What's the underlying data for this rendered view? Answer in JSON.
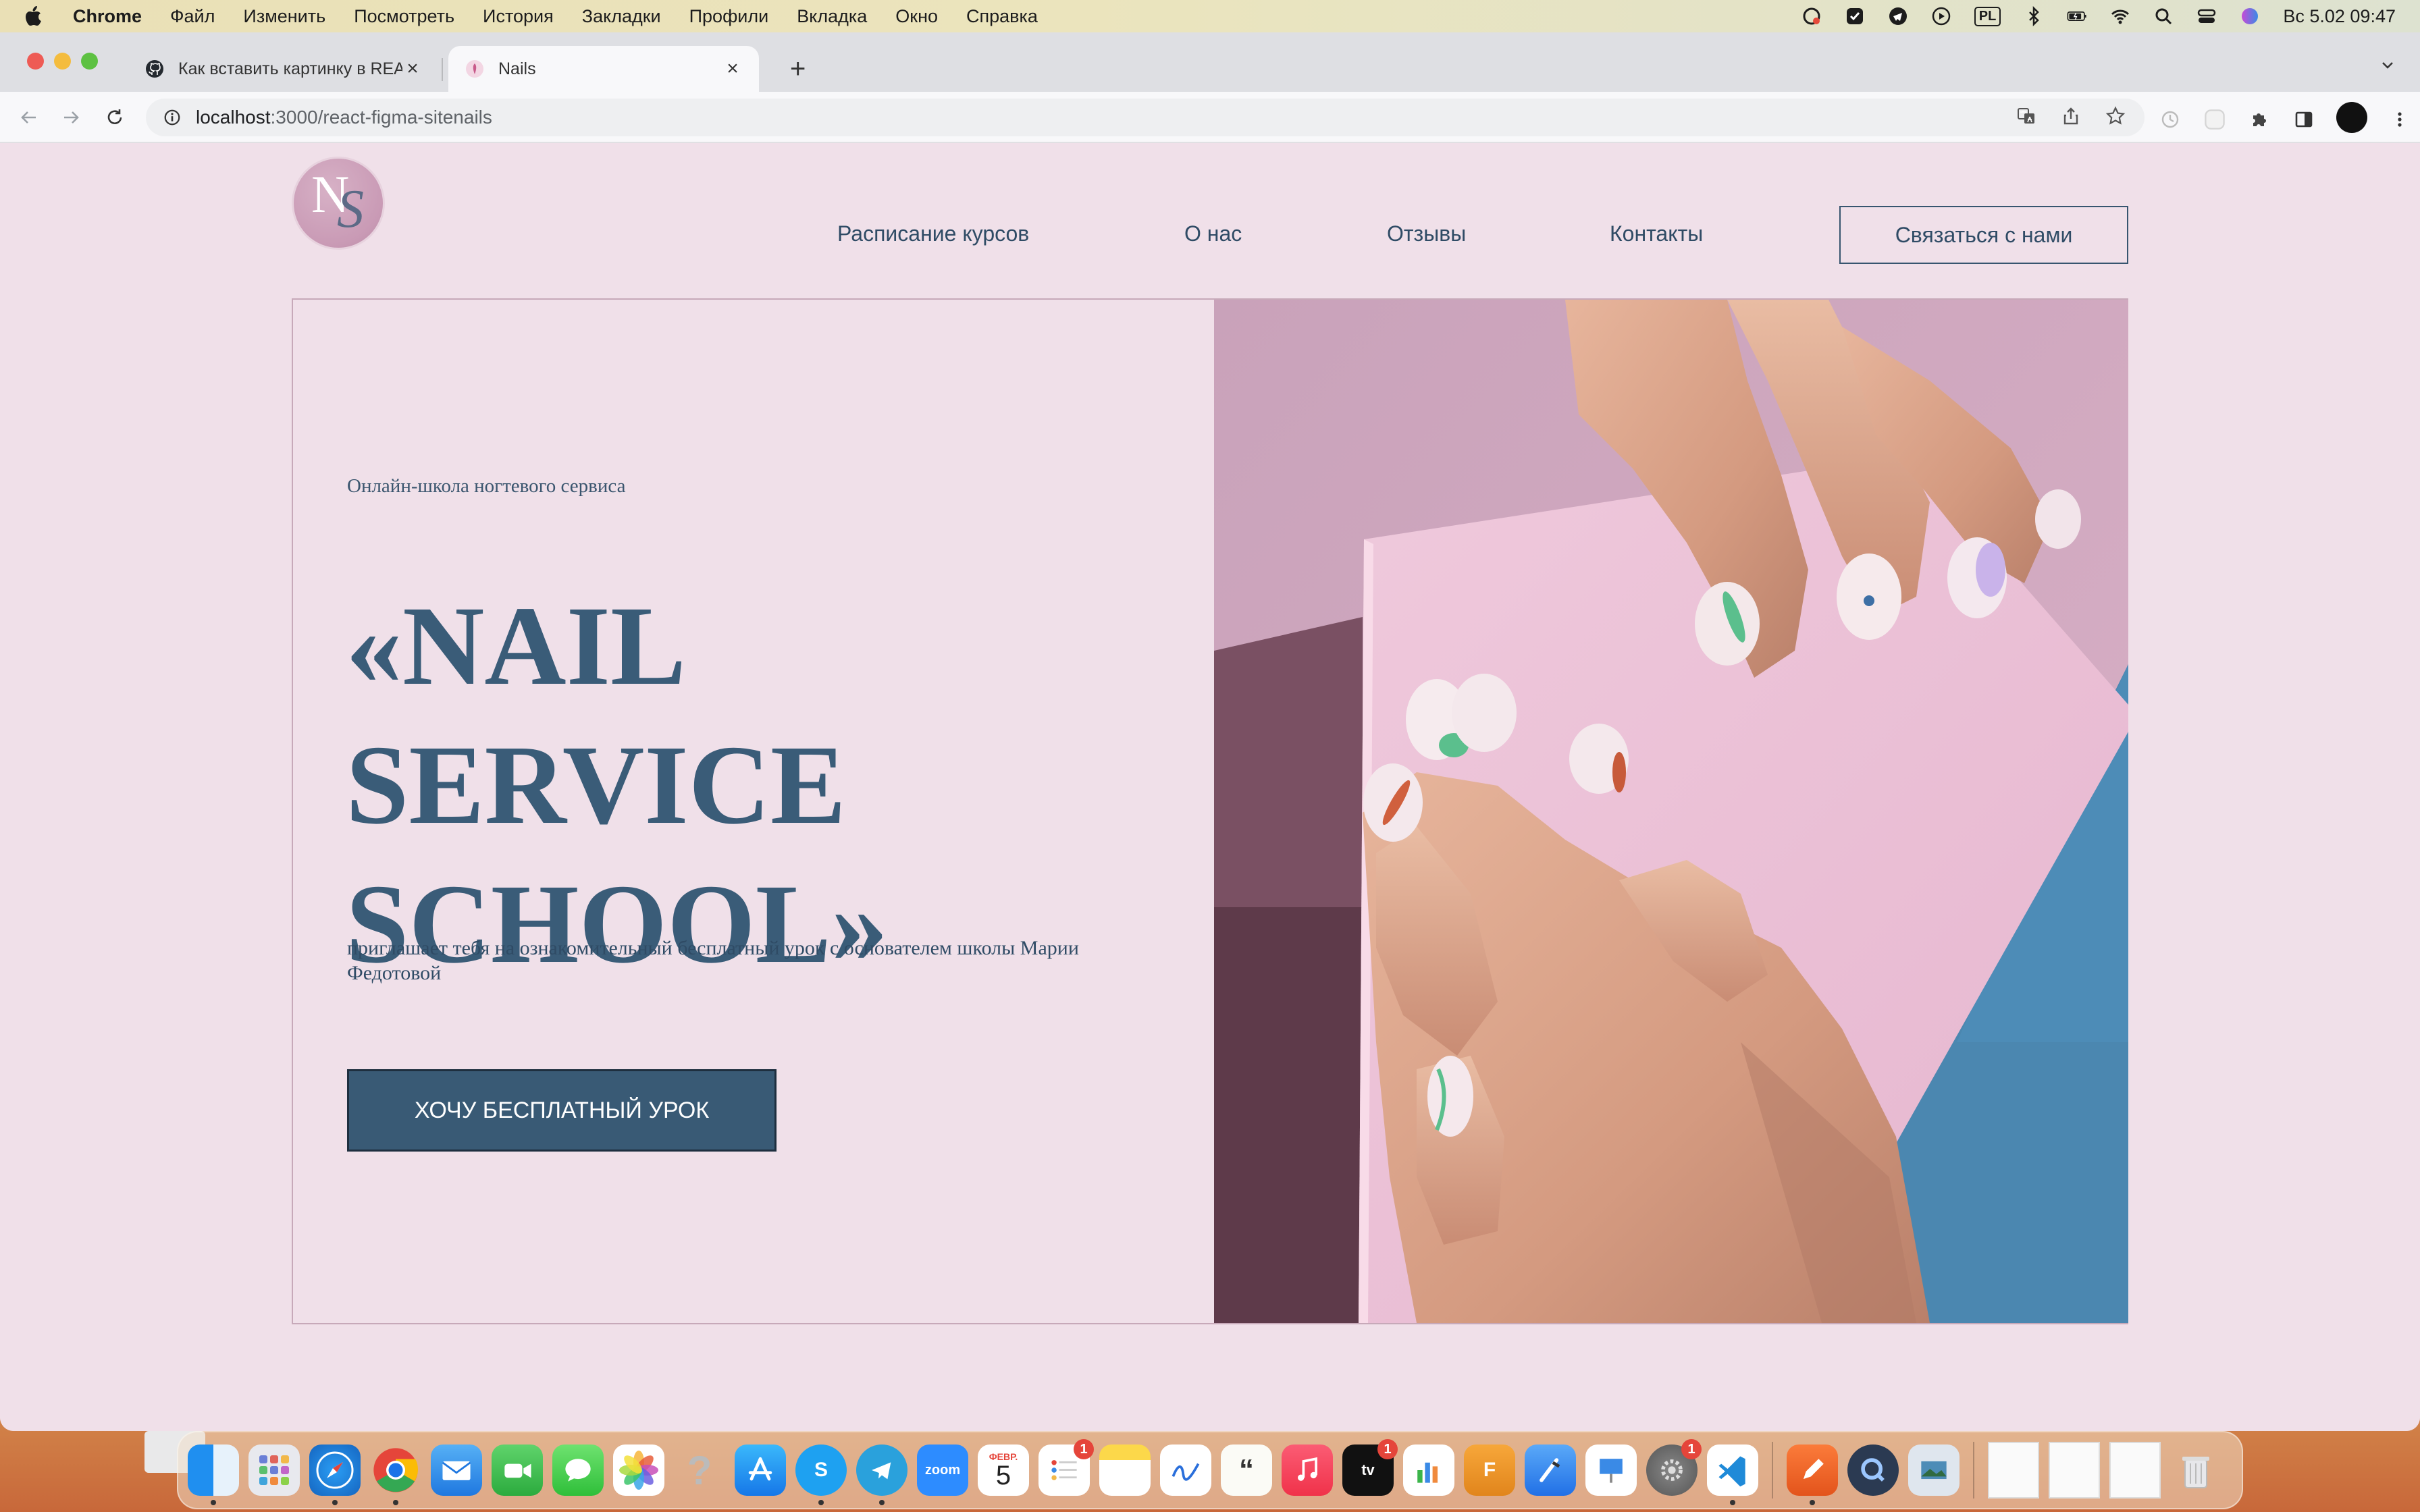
{
  "menubar": {
    "app_name": "Chrome",
    "items": [
      "Файл",
      "Изменить",
      "Посмотреть",
      "История",
      "Закладки",
      "Профили",
      "Вкладка",
      "Окно",
      "Справка"
    ],
    "input_source": "PL",
    "clock": "Вс 5.02  09:47"
  },
  "browser": {
    "tabs": [
      {
        "title": "Как вставить картинку в README",
        "favicon": "github-icon",
        "active": false
      },
      {
        "title": "Nails",
        "favicon": "nails-favicon",
        "active": true
      }
    ],
    "url_host": "localhost",
    "url_path": ":3000/react-figma-sitenails"
  },
  "site": {
    "logo": {
      "n": "N",
      "s": "S"
    },
    "nav": [
      "Расписание курсов",
      "О нас",
      "Отзывы",
      "Контакты"
    ],
    "contact_button": "Связаться с нами",
    "hero": {
      "kicker": "Онлайн-школа ногтевого сервиса",
      "headline": "«NAIL SERVICE\nSCHOOL»",
      "subtitle": "приглашает тебя на ознакомительный бесплатный урок с основателем школы Марии Федотовой",
      "button": "ХОЧУ БЕСПЛАТНЫЙ УРОК"
    }
  },
  "dock": {
    "calendar_month": "ФЕВР.",
    "calendar_day": "5",
    "zoom_label": "zoom",
    "badges": {
      "reminders": "1",
      "tv": "1",
      "settings": "1"
    }
  },
  "colors": {
    "page_bg": "#f0e0e9",
    "accent_blue": "#395a75",
    "headline": "#3a5c78"
  }
}
